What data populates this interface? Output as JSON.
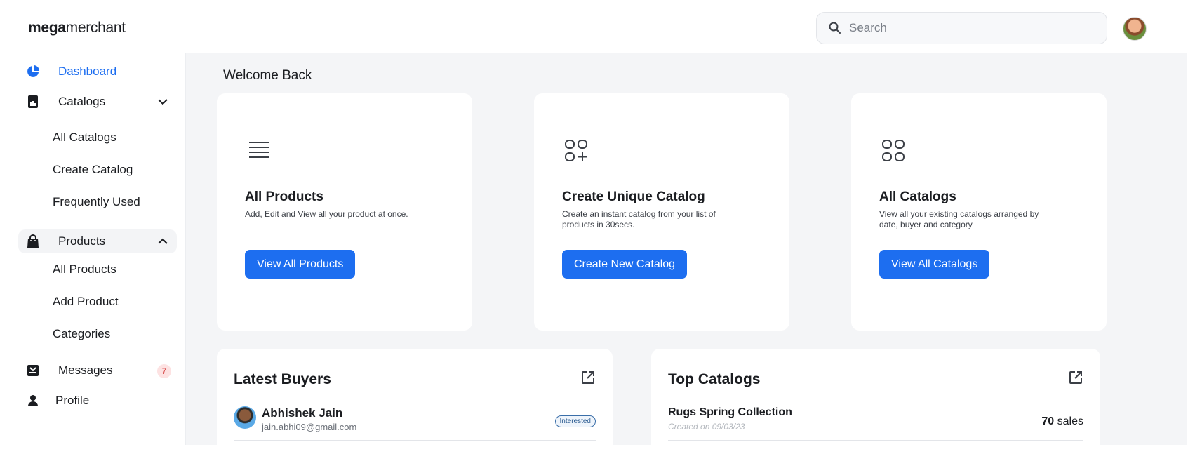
{
  "brand": {
    "bold": "mega",
    "light": "merchant"
  },
  "search": {
    "placeholder": "Search"
  },
  "sidebar": {
    "dashboard": "Dashboard",
    "catalogs": "Catalogs",
    "catalog_items": [
      "All Catalogs",
      "Create Catalog",
      "Frequently Used"
    ],
    "products": "Products",
    "product_items": [
      "All Products",
      "Add Product",
      "Categories"
    ],
    "messages": "Messages",
    "messages_count": "7",
    "profile": "Profile"
  },
  "main": {
    "welcome": "Welcome Back",
    "cards": [
      {
        "title": "All Products",
        "desc": "Add, Edit and View all your product at once.",
        "button": "View All Products",
        "icon": "list-icon"
      },
      {
        "title": "Create Unique Catalog",
        "desc": "Create an instant catalog from your list of products in 30secs.",
        "button": "Create New  Catalog",
        "icon": "add-grid-icon"
      },
      {
        "title": "All Catalogs",
        "desc": "View all your existing catalogs arranged by date, buyer and category",
        "button": "View All Catalogs",
        "icon": "grid-icon"
      }
    ],
    "latest_buyers": {
      "title": "Latest Buyers",
      "rows": [
        {
          "name": "Abhishek Jain",
          "email": "jain.abhi09@gmail.com",
          "status": "Interested"
        }
      ]
    },
    "top_catalogs": {
      "title": "Top Catalogs",
      "rows": [
        {
          "name": "Rugs Spring Collection",
          "created": "Created on 09/03/23",
          "sales_count": "70",
          "sales_unit": "sales"
        }
      ]
    }
  },
  "colors": {
    "accent": "#1d6ef0",
    "badge": "#d64545",
    "background": "#f4f5f7"
  }
}
